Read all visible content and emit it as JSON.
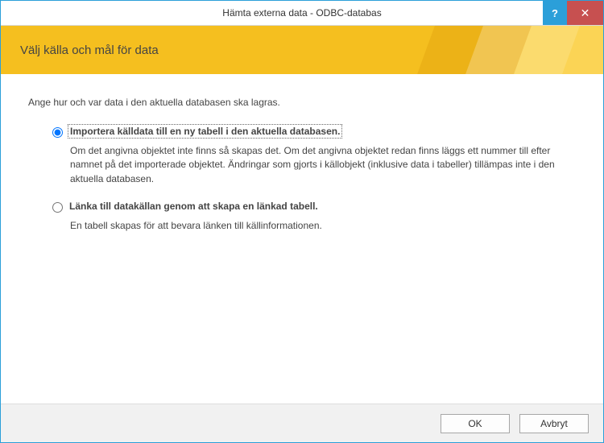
{
  "titlebar": {
    "title": "Hämta externa data - ODBC-databas",
    "help_symbol": "?",
    "close_symbol": "✕"
  },
  "banner": {
    "heading": "Välj källa och mål för data"
  },
  "content": {
    "intro": "Ange hur och var data i den aktuella databasen ska lagras.",
    "options": [
      {
        "value": "import",
        "selected": true,
        "label": "Importera källdata till en ny tabell i den aktuella databasen.",
        "description": "Om det angivna objektet inte finns så skapas det. Om det angivna objektet redan finns läggs ett nummer till efter namnet på det importerade objektet. Ändringar som gjorts i källobjekt (inklusive data i tabeller) tillämpas inte i den aktuella databasen."
      },
      {
        "value": "link",
        "selected": false,
        "label": "Länka till datakällan genom att skapa en länkad tabell.",
        "description": "En tabell skapas för att bevara länken till källinformationen."
      }
    ]
  },
  "footer": {
    "ok_label": "OK",
    "cancel_label": "Avbryt"
  }
}
